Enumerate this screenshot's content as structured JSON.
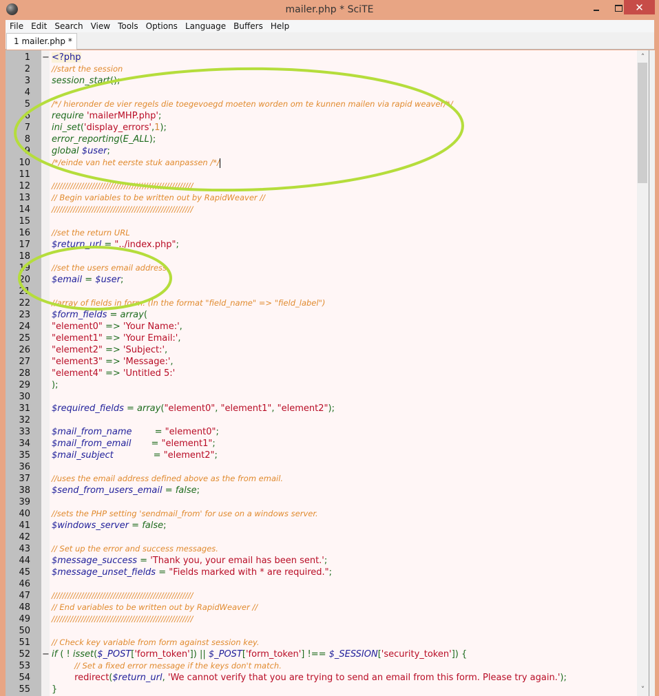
{
  "window": {
    "title": "mailer.php * SciTE",
    "controls": {
      "minimize": "minimize",
      "maximize": "maximize",
      "close": "✕"
    }
  },
  "menu": [
    "File",
    "Edit",
    "Search",
    "View",
    "Tools",
    "Options",
    "Language",
    "Buffers",
    "Help"
  ],
  "tabs": [
    {
      "label": "1 mailer.php *",
      "active": true
    }
  ],
  "colors": {
    "titlebar": "#e8a584",
    "close_button": "#c74c48",
    "editor_bg": "#fff6f6",
    "gutter_bg": "#c0c0c0",
    "comment": "#e08a2e",
    "string": "#b80d26",
    "variable": "#1f1f9a",
    "function": "#1d6b1d",
    "annotation": "#b5dd3c"
  },
  "editor": {
    "first_visible_line": 1,
    "caret_line": 10,
    "lines": [
      {
        "n": 1,
        "fold": "−",
        "tokens": [
          [
            "tag",
            "<?php"
          ]
        ]
      },
      {
        "n": 2,
        "tokens": [
          [
            "com",
            "//start the session"
          ]
        ]
      },
      {
        "n": 3,
        "tokens": [
          [
            "fn",
            "session_start"
          ],
          [
            "op",
            "();"
          ]
        ]
      },
      {
        "n": 4,
        "tokens": []
      },
      {
        "n": 5,
        "tokens": [
          [
            "com",
            "/*/ hieronder de vier regels die toegevoegd moeten worden om te kunnen mailen via rapid weaver/*/"
          ]
        ]
      },
      {
        "n": 6,
        "tokens": [
          [
            "kw",
            "require"
          ],
          [
            "plain",
            " "
          ],
          [
            "str",
            "'mailerMHP.php'"
          ],
          [
            "op",
            ";"
          ]
        ]
      },
      {
        "n": 7,
        "tokens": [
          [
            "fn",
            "ini_set"
          ],
          [
            "op",
            "("
          ],
          [
            "str",
            "'display_errors'"
          ],
          [
            "op",
            ","
          ],
          [
            "num",
            "1"
          ],
          [
            "op",
            ");"
          ]
        ]
      },
      {
        "n": 8,
        "tokens": [
          [
            "fn",
            "error_reporting"
          ],
          [
            "op",
            "("
          ],
          [
            "fn",
            "E_ALL"
          ],
          [
            "op",
            ");"
          ]
        ]
      },
      {
        "n": 9,
        "tokens": [
          [
            "kw",
            "global"
          ],
          [
            "plain",
            " "
          ],
          [
            "var",
            "$user"
          ],
          [
            "op",
            ";"
          ]
        ]
      },
      {
        "n": 10,
        "tokens": [
          [
            "com",
            "/*/einde van het eerste stuk aanpassen /*/"
          ]
        ],
        "caret": true
      },
      {
        "n": 11,
        "tokens": []
      },
      {
        "n": 12,
        "tokens": [
          [
            "com",
            "/////////////////////////////////////////////////////"
          ]
        ]
      },
      {
        "n": 13,
        "tokens": [
          [
            "com",
            "// Begin variables to be written out by RapidWeaver //"
          ]
        ]
      },
      {
        "n": 14,
        "tokens": [
          [
            "com",
            "/////////////////////////////////////////////////////"
          ]
        ]
      },
      {
        "n": 15,
        "tokens": []
      },
      {
        "n": 16,
        "tokens": [
          [
            "com",
            "//set the return URL"
          ]
        ]
      },
      {
        "n": 17,
        "tokens": [
          [
            "var",
            "$return_url"
          ],
          [
            "op",
            " = "
          ],
          [
            "str",
            "\"../index.php\""
          ],
          [
            "op",
            ";"
          ]
        ]
      },
      {
        "n": 18,
        "tokens": []
      },
      {
        "n": 19,
        "tokens": [
          [
            "com",
            "//set the users email address"
          ]
        ]
      },
      {
        "n": 20,
        "tokens": [
          [
            "var",
            "$email"
          ],
          [
            "op",
            " = "
          ],
          [
            "var",
            "$user"
          ],
          [
            "op",
            ";"
          ]
        ]
      },
      {
        "n": 21,
        "tokens": []
      },
      {
        "n": 22,
        "tokens": [
          [
            "com",
            "//array of fields in form. (In the format \"field_name\" => \"field_label\")"
          ]
        ]
      },
      {
        "n": 23,
        "tokens": [
          [
            "var",
            "$form_fields"
          ],
          [
            "op",
            " = "
          ],
          [
            "fn",
            "array"
          ],
          [
            "op",
            "("
          ]
        ]
      },
      {
        "n": 24,
        "tokens": [
          [
            "str",
            "\"element0\""
          ],
          [
            "op",
            " => "
          ],
          [
            "str",
            "'Your Name:'"
          ],
          [
            "op",
            ","
          ]
        ]
      },
      {
        "n": 25,
        "tokens": [
          [
            "str",
            "\"element1\""
          ],
          [
            "op",
            " => "
          ],
          [
            "str",
            "'Your Email:'"
          ],
          [
            "op",
            ","
          ]
        ]
      },
      {
        "n": 26,
        "tokens": [
          [
            "str",
            "\"element2\""
          ],
          [
            "op",
            " => "
          ],
          [
            "str",
            "'Subject:'"
          ],
          [
            "op",
            ","
          ]
        ]
      },
      {
        "n": 27,
        "tokens": [
          [
            "str",
            "\"element3\""
          ],
          [
            "op",
            " => "
          ],
          [
            "str",
            "'Message:'"
          ],
          [
            "op",
            ","
          ]
        ]
      },
      {
        "n": 28,
        "tokens": [
          [
            "str",
            "\"element4\""
          ],
          [
            "op",
            " => "
          ],
          [
            "str",
            "'Untitled 5:'"
          ]
        ]
      },
      {
        "n": 29,
        "tokens": [
          [
            "op",
            ");"
          ]
        ]
      },
      {
        "n": 30,
        "tokens": []
      },
      {
        "n": 31,
        "tokens": [
          [
            "var",
            "$required_fields"
          ],
          [
            "op",
            " = "
          ],
          [
            "fn",
            "array"
          ],
          [
            "op",
            "("
          ],
          [
            "str",
            "\"element0\""
          ],
          [
            "op",
            ", "
          ],
          [
            "str",
            "\"element1\""
          ],
          [
            "op",
            ", "
          ],
          [
            "str",
            "\"element2\""
          ],
          [
            "op",
            ");"
          ]
        ]
      },
      {
        "n": 32,
        "tokens": []
      },
      {
        "n": 33,
        "tokens": [
          [
            "var",
            "$mail_from_name        "
          ],
          [
            "op",
            "= "
          ],
          [
            "str",
            "\"element0\""
          ],
          [
            "op",
            ";"
          ]
        ]
      },
      {
        "n": 34,
        "tokens": [
          [
            "var",
            "$mail_from_email       "
          ],
          [
            "op",
            "= "
          ],
          [
            "str",
            "\"element1\""
          ],
          [
            "op",
            ";"
          ]
        ]
      },
      {
        "n": 35,
        "tokens": [
          [
            "var",
            "$mail_subject              "
          ],
          [
            "op",
            "= "
          ],
          [
            "str",
            "\"element2\""
          ],
          [
            "op",
            ";"
          ]
        ]
      },
      {
        "n": 36,
        "tokens": []
      },
      {
        "n": 37,
        "tokens": [
          [
            "com",
            "//uses the email address defined above as the from email."
          ]
        ]
      },
      {
        "n": 38,
        "tokens": [
          [
            "var",
            "$send_from_users_email"
          ],
          [
            "op",
            " = "
          ],
          [
            "fn",
            "false"
          ],
          [
            "op",
            ";"
          ]
        ]
      },
      {
        "n": 39,
        "tokens": []
      },
      {
        "n": 40,
        "tokens": [
          [
            "com",
            "//sets the PHP setting 'sendmail_from' for use on a windows server."
          ]
        ]
      },
      {
        "n": 41,
        "tokens": [
          [
            "var",
            "$windows_server"
          ],
          [
            "op",
            " = "
          ],
          [
            "fn",
            "false"
          ],
          [
            "op",
            ";"
          ]
        ]
      },
      {
        "n": 42,
        "tokens": []
      },
      {
        "n": 43,
        "tokens": [
          [
            "com",
            "// Set up the error and success messages."
          ]
        ]
      },
      {
        "n": 44,
        "tokens": [
          [
            "var",
            "$message_success"
          ],
          [
            "op",
            " = "
          ],
          [
            "str",
            "'Thank you, your email has been sent.'"
          ],
          [
            "op",
            ";"
          ]
        ]
      },
      {
        "n": 45,
        "tokens": [
          [
            "var",
            "$message_unset_fields"
          ],
          [
            "op",
            " = "
          ],
          [
            "str",
            "\"Fields marked with * are required.\""
          ],
          [
            "op",
            ";"
          ]
        ]
      },
      {
        "n": 46,
        "tokens": []
      },
      {
        "n": 47,
        "tokens": [
          [
            "com",
            "/////////////////////////////////////////////////////"
          ]
        ]
      },
      {
        "n": 48,
        "tokens": [
          [
            "com",
            "// End variables to be written out by RapidWeaver //"
          ]
        ]
      },
      {
        "n": 49,
        "tokens": [
          [
            "com",
            "/////////////////////////////////////////////////////"
          ]
        ]
      },
      {
        "n": 50,
        "tokens": []
      },
      {
        "n": 51,
        "tokens": [
          [
            "com",
            "// Check key variable from form against session key."
          ]
        ]
      },
      {
        "n": 52,
        "fold": "−",
        "tokens": [
          [
            "kw",
            "if"
          ],
          [
            "op",
            " ( ! "
          ],
          [
            "fn",
            "isset"
          ],
          [
            "op",
            "("
          ],
          [
            "var",
            "$_POST"
          ],
          [
            "op",
            "["
          ],
          [
            "str",
            "'form_token'"
          ],
          [
            "op",
            "]) || "
          ],
          [
            "var",
            "$_POST"
          ],
          [
            "op",
            "["
          ],
          [
            "str",
            "'form_token'"
          ],
          [
            "op",
            "] !== "
          ],
          [
            "var",
            "$_SESSION"
          ],
          [
            "op",
            "["
          ],
          [
            "str",
            "'security_token'"
          ],
          [
            "op",
            "]) {"
          ]
        ]
      },
      {
        "n": 53,
        "tokens": [
          [
            "plain",
            "        "
          ],
          [
            "com",
            "// Set a fixed error message if the keys don't match."
          ]
        ]
      },
      {
        "n": 54,
        "tokens": [
          [
            "plain",
            "        "
          ],
          [
            "str",
            "redirect"
          ],
          [
            "op",
            "("
          ],
          [
            "var",
            "$return_url"
          ],
          [
            "op",
            ", "
          ],
          [
            "str",
            "'We cannot verify that you are trying to send an email from this form. Please try again.'"
          ],
          [
            "op",
            ");"
          ]
        ]
      },
      {
        "n": 55,
        "tokens": [
          [
            "op",
            "}"
          ]
        ]
      }
    ]
  },
  "scrollbar": {
    "up": "˄",
    "down": "˅",
    "position_fraction": 0.0,
    "visible_fraction": 0.19
  },
  "annotations": [
    {
      "shape": "ellipse",
      "color": "#b5dd3c",
      "around_lines": "5-10"
    },
    {
      "shape": "ellipse",
      "color": "#b5dd3c",
      "around_lines": "19-20"
    }
  ]
}
